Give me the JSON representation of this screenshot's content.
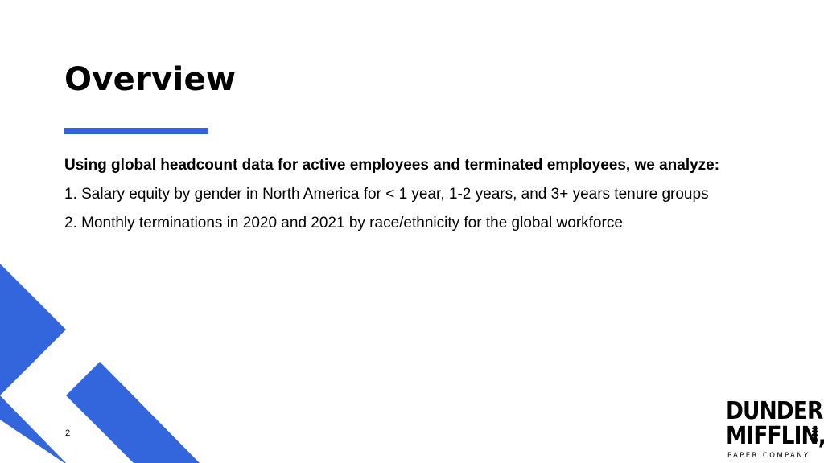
{
  "slide": {
    "title": "Overview",
    "intro": "Using global headcount data for active employees and terminated employees, we analyze:",
    "points": [
      "1. Salary equity by gender in North America for < 1 year, 1-2 years, and 3+ years tenure groups",
      "2. Monthly terminations in 2020 and 2021 by race/ethnicity for the global workforce"
    ],
    "page_number": "2"
  },
  "logo": {
    "line1": "DUNDER",
    "line2": "MIFFLIN,",
    "inc": "INC",
    "tagline": "PAPER COMPANY"
  },
  "colors": {
    "accent": "#3366dd",
    "text": "#000000",
    "background": "#ffffff"
  }
}
